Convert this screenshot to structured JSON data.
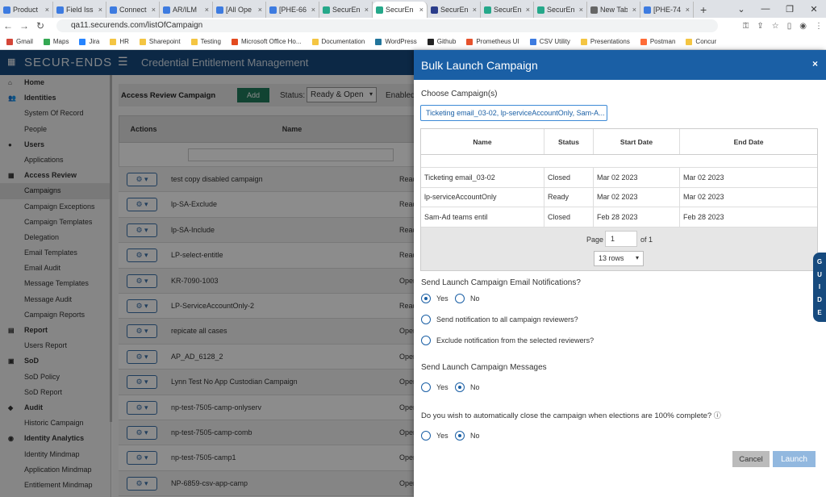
{
  "browser": {
    "tabs": [
      {
        "label": "Product",
        "color": "#3d7be0"
      },
      {
        "label": "Field Iss",
        "color": "#3d7be0"
      },
      {
        "label": "Connect",
        "color": "#3d7be0"
      },
      {
        "label": "AR/ILM",
        "color": "#3d7be0"
      },
      {
        "label": "[All Ope",
        "color": "#3d7be0"
      },
      {
        "label": "[PHE-66",
        "color": "#3d7be0"
      },
      {
        "label": "SecurEn",
        "color": "#25a88a"
      },
      {
        "label": "SecurEn",
        "color": "#25a88a",
        "active": true
      },
      {
        "label": "SecurEn",
        "color": "#2a3c8a"
      },
      {
        "label": "SecurEn",
        "color": "#25a88a"
      },
      {
        "label": "SecurEn",
        "color": "#25a88a"
      },
      {
        "label": "New Tab",
        "color": "#666666"
      },
      {
        "label": "[PHE-74",
        "color": "#3d7be0"
      }
    ],
    "new_tab": "+",
    "url": "qa11.securends.com/listOfCampaign",
    "bookmarks": [
      {
        "label": "Gmail",
        "color": "#d44638"
      },
      {
        "label": "Maps",
        "color": "#34a853"
      },
      {
        "label": "Jira",
        "color": "#2684ff"
      },
      {
        "label": "HR",
        "color": "#f4c542"
      },
      {
        "label": "Sharepoint",
        "color": "#f4c542"
      },
      {
        "label": "Testing",
        "color": "#f4c542"
      },
      {
        "label": "Microsoft Office Ho...",
        "color": "#e34a1f"
      },
      {
        "label": "Documentation",
        "color": "#f4c542"
      },
      {
        "label": "WordPress",
        "color": "#21759b"
      },
      {
        "label": "Github",
        "color": "#222222"
      },
      {
        "label": "Prometheus UI",
        "color": "#e6522c"
      },
      {
        "label": "CSV Utility",
        "color": "#3d7be0"
      },
      {
        "label": "Presentations",
        "color": "#f4c542"
      },
      {
        "label": "Postman",
        "color": "#ff6c37"
      },
      {
        "label": "Concur",
        "color": "#f4c542"
      }
    ]
  },
  "app": {
    "brand": "SECUR-ENDS",
    "title": "Credential Entitlement Management"
  },
  "sidebar": [
    {
      "label": "Home",
      "head": true,
      "icon": "home-icon",
      "glyph": "⌂"
    },
    {
      "label": "Identities",
      "head": true,
      "icon": "users-icon",
      "glyph": "👥"
    },
    {
      "label": "System Of Record"
    },
    {
      "label": "People"
    },
    {
      "label": "Users",
      "head": true,
      "icon": "user-icon",
      "glyph": "●"
    },
    {
      "label": "Applications"
    },
    {
      "label": "Access Review",
      "head": true,
      "icon": "grid-icon",
      "glyph": "▦"
    },
    {
      "label": "Campaigns",
      "active": true
    },
    {
      "label": "Campaign Exceptions"
    },
    {
      "label": "Campaign Templates"
    },
    {
      "label": "Delegation"
    },
    {
      "label": "Email Templates"
    },
    {
      "label": "Email Audit"
    },
    {
      "label": "Message Templates"
    },
    {
      "label": "Message Audit"
    },
    {
      "label": "Campaign Reports"
    },
    {
      "label": "Report",
      "head": true,
      "icon": "report-icon",
      "glyph": "▤"
    },
    {
      "label": "Users Report"
    },
    {
      "label": "SoD",
      "head": true,
      "icon": "sod-icon",
      "glyph": "▣"
    },
    {
      "label": "SoD Policy"
    },
    {
      "label": "SoD Report"
    },
    {
      "label": "Audit",
      "head": true,
      "icon": "shield-icon",
      "glyph": "◆"
    },
    {
      "label": "Historic Campaign"
    },
    {
      "label": "Identity Analytics",
      "head": true,
      "icon": "analytics-icon",
      "glyph": "◉"
    },
    {
      "label": "Identity Mindmap"
    },
    {
      "label": "Application Mindmap"
    },
    {
      "label": "Entitlement Mindmap"
    }
  ],
  "main": {
    "toolbar_title": "Access Review Campaign",
    "add_label": "Add",
    "status_label": "Status:",
    "status_value": "Ready & Open",
    "enabled_label": "Enabled",
    "col_actions": "Actions",
    "col_name": "Name",
    "rows": [
      {
        "name": "test copy disabled campaign",
        "status": "Read"
      },
      {
        "name": "lp-SA-Exclude",
        "status": "Read"
      },
      {
        "name": "lp-SA-Include",
        "status": "Read"
      },
      {
        "name": "LP-select-entitle",
        "status": "Read"
      },
      {
        "name": "KR-7090-1003",
        "status": "Oper"
      },
      {
        "name": "LP-ServiceAccountOnly-2",
        "status": "Read"
      },
      {
        "name": "repicate all cases",
        "status": "Oper"
      },
      {
        "name": "AP_AD_6128_2",
        "status": "Oper"
      },
      {
        "name": "Lynn Test No App Custodian Campaign",
        "status": "Oper"
      },
      {
        "name": "np-test-7505-camp-onlyserv",
        "status": "Oper"
      },
      {
        "name": "np-test-7505-camp-comb",
        "status": "Oper"
      },
      {
        "name": "np-test-7505-camp1",
        "status": "Oper"
      },
      {
        "name": "NP-6859-csv-app-camp",
        "status": "Oper"
      }
    ]
  },
  "modal": {
    "title": "Bulk Launch Campaign",
    "close": "×",
    "choose_label": "Choose Campaign(s)",
    "choose_value": "Ticketing email_03-02, lp-serviceAccountOnly, Sam-A...",
    "columns": [
      "Name",
      "Status",
      "Start Date",
      "End Date"
    ],
    "campaigns": [
      {
        "name": "Ticketing email_03-02",
        "status": "Closed",
        "start": "Mar 02 2023",
        "end": "Mar 02 2023"
      },
      {
        "name": "lp-serviceAccountOnly",
        "status": "Ready",
        "start": "Mar 02 2023",
        "end": "Mar 02 2023"
      },
      {
        "name": "Sam-Ad teams entil",
        "status": "Closed",
        "start": "Feb 28 2023",
        "end": "Feb 28 2023"
      }
    ],
    "page_label": "Page",
    "page_value": "1",
    "page_of": "of 1",
    "rows_value": "13 rows",
    "email_q": "Send Launch Campaign Email Notifications?",
    "yes": "Yes",
    "no": "No",
    "notify_all": "Send notification to all campaign reviewers?",
    "notify_exclude": "Exclude notification from the selected reviewers?",
    "messages_q": "Send Launch Campaign Messages",
    "close_q": "Do you wish to automatically close the campaign when elections are 100% complete?",
    "cancel": "Cancel",
    "launch": "Launch"
  },
  "guide": [
    "G",
    "U",
    "I",
    "D",
    "E"
  ]
}
